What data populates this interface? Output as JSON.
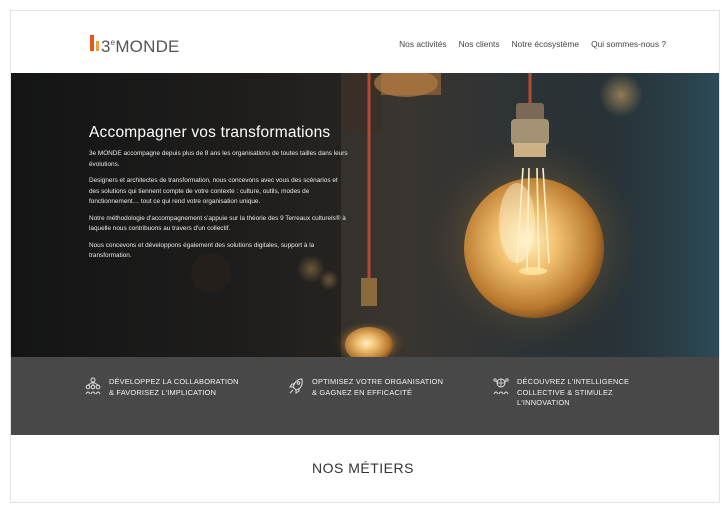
{
  "header": {
    "logo_prefix": "3",
    "logo_sup": "e",
    "logo_suffix": "MONDE",
    "nav": [
      {
        "label": "Nos activités"
      },
      {
        "label": "Nos clients"
      },
      {
        "label": "Notre écosystème"
      },
      {
        "label": "Qui sommes-nous ?"
      }
    ]
  },
  "hero": {
    "title": "Accompagner vos transformations",
    "paragraphs": [
      "3e MONDE accompagne depuis plus de 8 ans les organisations de toutes tailles dans leurs évolutions.",
      "Designers et architectes de transformation, nous concevons avec vous des scénarios et des solutions qui tiennent compte de votre contexte : culture, outils, modes de fonctionnement… tout ce qui rend votre organisation unique.",
      "Notre méthodologie d'accompagnement s'appuie sur la théorie des 9 Terreaux culturels® à laquelle nous contribuons au travers d'un collectif.",
      "Nous concevons et développons également des solutions digitales, support à la transformation."
    ]
  },
  "features": [
    {
      "icon": "people-network-icon",
      "lines": [
        "DÉVELOPPEZ LA COLLABORATION",
        "& FAVORISEZ L'IMPLICATION"
      ]
    },
    {
      "icon": "rocket-icon",
      "lines": [
        "OPTIMISEZ VOTRE ORGANISATION",
        "& GAGNEZ EN EFFICACITÉ"
      ]
    },
    {
      "icon": "brain-network-icon",
      "lines": [
        "DÉCOUVREZ L'INTELLIGENCE",
        "COLLECTIVE & STIMULEZ",
        "L'INNOVATION"
      ]
    }
  ],
  "section": {
    "title": "NOS MÉTIERS"
  },
  "colors": {
    "band": "#484848",
    "accent": "#e8561f",
    "bulb_glow": "#f7c56a"
  }
}
